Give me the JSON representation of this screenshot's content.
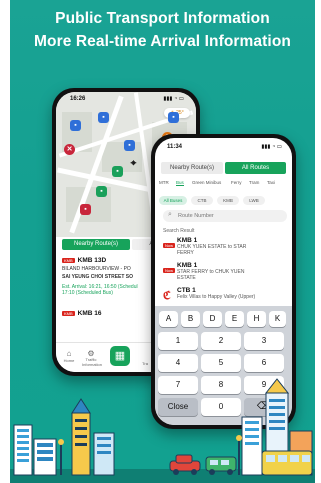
{
  "headline": {
    "line1": "Public Transport Information",
    "line2": "More Real-time Arrival Information"
  },
  "back_phone": {
    "status_time": "16:26",
    "weather": "25°",
    "tabs": [
      "Nearby Route(s)",
      "Al"
    ],
    "routes": [
      {
        "name": "KMB 13D",
        "from_to": "BILAND HARBOURVIEW - PO",
        "stop": "SAI YEUNG CHOI STREET SO",
        "eta_line1": "Est. Arrival: 16:21, 16:50 (Schedul",
        "eta_line2": "17:10 (Scheduled Bus)"
      },
      {
        "name": "KMB 16"
      }
    ],
    "nav": [
      "Home",
      "Traffic Information",
      "Tra"
    ]
  },
  "front_phone": {
    "status_time": "11:34",
    "tabs": [
      "Nearby Route(s)",
      "All Routes"
    ],
    "modes": [
      "MTR",
      "Bus",
      "Green Minibus",
      "Ferry",
      "Tram",
      "Taxi"
    ],
    "operators": [
      "All Buses",
      "CTB",
      "KMB",
      "LWB"
    ],
    "search_placeholder": "Route Number",
    "search_result_label": "Search Result",
    "results": [
      {
        "name": "KMB 1",
        "badge": "Now",
        "desc_line1": "CHUK YUEN ESTATE to STAR",
        "desc_line2": "FERRY"
      },
      {
        "name": "KMB 1",
        "badge": "Now",
        "desc_line1": "STAR FERRY to CHUK YUEN",
        "desc_line2": "ESTATE"
      },
      {
        "name": "CTB 1",
        "badge": "",
        "desc_line1": "Felix Villas to Happy Valley (Upper)",
        "desc_line2": ""
      }
    ],
    "keyboard": {
      "letters": [
        "A",
        "B",
        "D",
        "E",
        "H",
        "K"
      ],
      "numbers": [
        "1",
        "2",
        "3",
        "4",
        "5",
        "6",
        "7",
        "8",
        "9"
      ],
      "close": "Close",
      "zero": "0",
      "backspace": "⌫"
    }
  },
  "colors": {
    "background": "#14a091",
    "accent_green": "#17a35b",
    "red": "#d9241c"
  }
}
